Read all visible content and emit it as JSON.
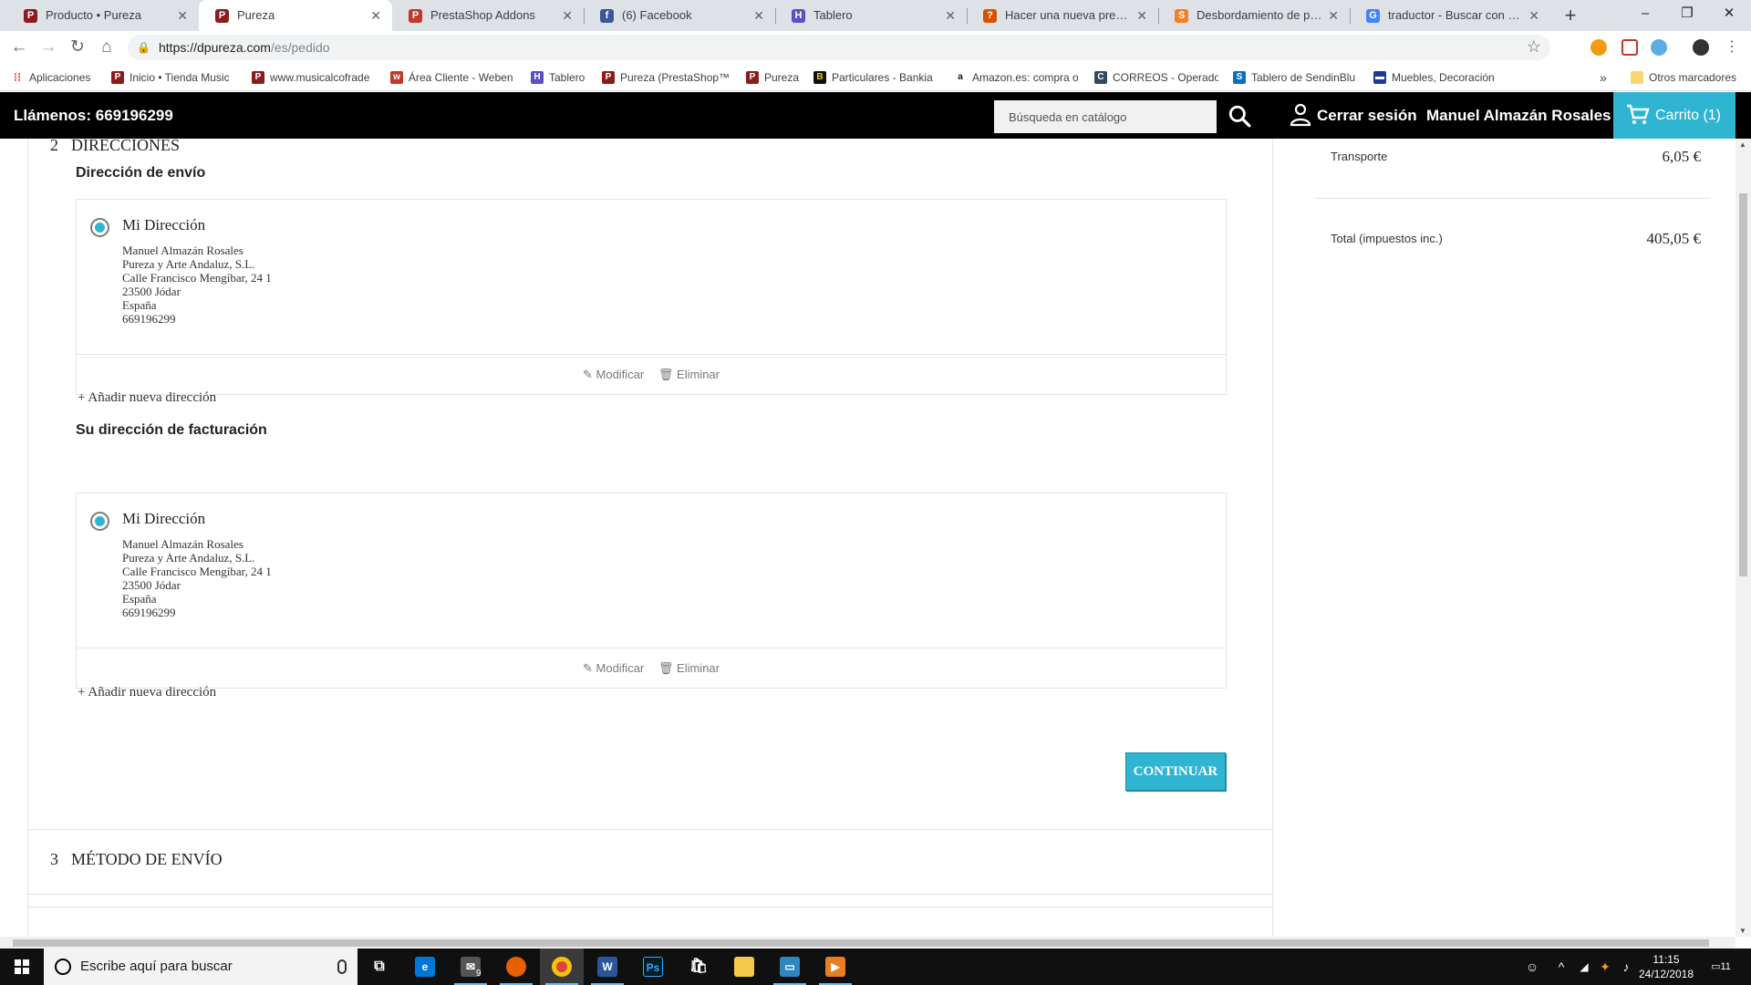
{
  "browser": {
    "tabs": [
      {
        "label": "Producto • Pureza",
        "active": false
      },
      {
        "label": "Pureza",
        "active": true
      },
      {
        "label": "PrestaShop Addons",
        "active": false
      },
      {
        "label": "(6) Facebook",
        "active": false
      },
      {
        "label": "Tablero",
        "active": false
      },
      {
        "label": "Hacer una nueva pregunta",
        "active": false
      },
      {
        "label": "Desbordamiento de pila: do",
        "active": false
      },
      {
        "label": "traductor - Buscar con Goo",
        "active": false
      }
    ],
    "url_host": "https://dpureza.com",
    "url_path": "/es/pedido",
    "bookmarks": [
      "Aplicaciones",
      "Inicio • Tienda Music",
      "www.musicalcofrade",
      "Área Cliente - Weben",
      "Tablero",
      "Pureza (PrestaShop™",
      "Pureza",
      "Particulares - Bankia",
      "Amazon.es: compra o",
      "CORREOS - Operado",
      "Tablero de SendinBlu",
      "Muebles, Decoración"
    ],
    "bookmarks_overflow": "»",
    "other_bookmarks": "Otros marcadores"
  },
  "header": {
    "phone": "Llámenos: 669196299",
    "search_placeholder": "Búsqueda en catálogo",
    "logout": "Cerrar sesión",
    "username": "Manuel Almazán Rosales",
    "cart": "Carrito (1)"
  },
  "checkout": {
    "step2": {
      "number": "2",
      "title": "DIRECCIONES"
    },
    "shipping_heading": "Dirección de envío",
    "billing_heading": "Su dirección de facturación",
    "shipping_address": {
      "alias": "Mi Dirección",
      "lines": [
        "Manuel Almazán Rosales",
        "Pureza y Arte Andaluz, S.L.",
        "Calle Francisco Mengíbar, 24 1",
        "23500 Jódar",
        "España",
        "669196299"
      ],
      "edit": "Modificar",
      "delete": "Eliminar"
    },
    "billing_address": {
      "alias": "Mi Dirección",
      "lines": [
        "Manuel Almazán Rosales",
        "Pureza y Arte Andaluz, S.L.",
        "Calle Francisco Mengíbar, 24 1",
        "23500 Jódar",
        "España",
        "669196299"
      ],
      "edit": "Modificar",
      "delete": "Eliminar"
    },
    "add_address": "+ Añadir nueva dirección",
    "continue": "CONTINUAR",
    "step3": {
      "number": "3",
      "title": "MÉTODO DE ENVÍO"
    }
  },
  "summary": {
    "shipping_label": "Transporte",
    "shipping_value": "6,05 €",
    "total_label": "Total (impuestos inc.)",
    "total_value": "405,05 €"
  },
  "taskbar": {
    "search_placeholder": "Escribe aquí para buscar",
    "mail_badge": "9",
    "time": "11:15",
    "date": "24/12/2018",
    "notifications": "11"
  },
  "colors": {
    "accent": "#2fb5d2",
    "header_bg": "#000000"
  }
}
